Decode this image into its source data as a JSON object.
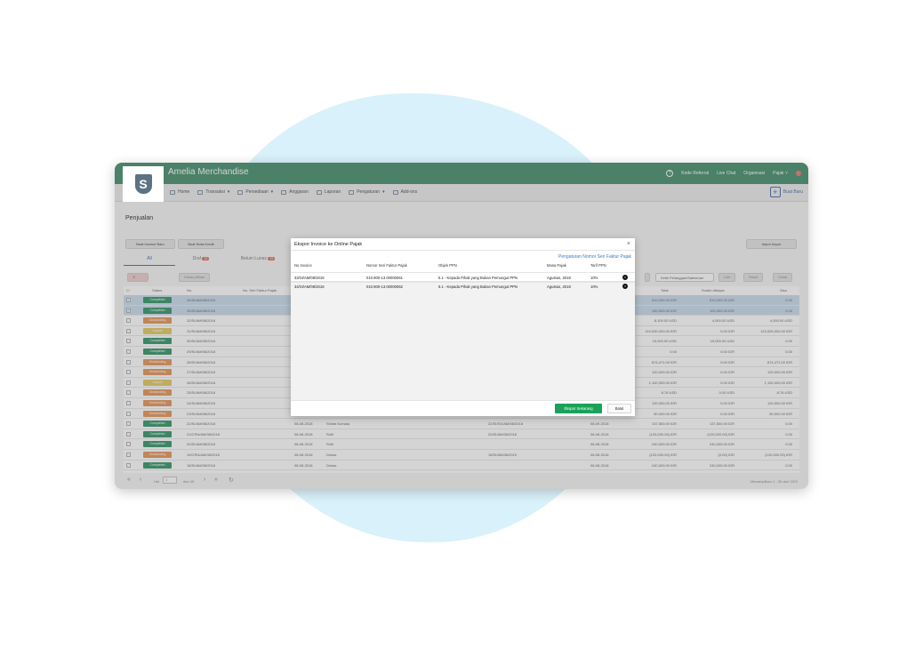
{
  "app": {
    "title": "Amelia Merchandise",
    "logo_letter": "S"
  },
  "topbar": {
    "help": "?",
    "kode_referral": "Kode Referral",
    "live_chat": "Live Chat",
    "organisasi": "Organisasi",
    "user": "Pajak",
    "brand_color": "#5a9c7d"
  },
  "nav": {
    "items": [
      "Home",
      "Transaksi",
      "Persediaan",
      "Anggaran",
      "Laporan",
      "Pengaturan",
      "Add-ons"
    ],
    "create": "Buat Baru"
  },
  "page": {
    "title": "Penjualan",
    "btn_new_invoice": "Buat Invoice Baru",
    "btn_new_credit": "Buat Nota Kredit",
    "btn_import": "Impor Impor",
    "tabs": [
      {
        "label": "All"
      },
      {
        "label": "Draf",
        "count": "10"
      },
      {
        "label": "Belum Lunas",
        "count": "29"
      }
    ],
    "toolbar": {
      "cetak": "Cetak pilihan",
      "search_placeholder": "Ketik Pelanggan/Salesman",
      "cari": "Cari",
      "reset": "Reset",
      "cetak2": "Cetak"
    }
  },
  "table": {
    "headers": {
      "status": "Status",
      "no": "No.",
      "faktur": "No. Seri Faktur Pajak",
      "total": "Total",
      "sudah": "Sudah dibayar",
      "sisa": "Sisa"
    },
    "rows": [
      {
        "selected": true,
        "status": "Completed",
        "color": "#4aa07a",
        "no": "34/SI/AM/08/2018",
        "date": "",
        "cust": "",
        "ref": "",
        "due": "",
        "total": "519,000.00 IDR",
        "paid": "519,000.00 IDR",
        "rest": "0.00"
      },
      {
        "selected": true,
        "status": "Completed",
        "color": "#4aa07a",
        "no": "33/SI/AM/08/2018",
        "date": "",
        "cust": "",
        "ref": "",
        "due": "",
        "total": "100,000.00 IDR",
        "paid": "100,000.00 IDR",
        "rest": "0.00"
      },
      {
        "selected": false,
        "status": "Outstanding",
        "color": "#e7a06a",
        "no": "32/SI/AM/08/2018",
        "date": "",
        "cust": "",
        "ref": "",
        "due": "",
        "total": "8,100.00 USD",
        "paid": "4,000.00 USD",
        "rest": "4,000.00 USD"
      },
      {
        "selected": false,
        "status": "Unpaid",
        "color": "#e6cf72",
        "no": "31/SI/AM/08/2018",
        "date": "",
        "cust": "",
        "ref": "",
        "due": "",
        "total": "110,000,000.00 IDR",
        "paid": "0.00 IDR",
        "rest": "110,000,000.00 IDR"
      },
      {
        "selected": false,
        "status": "Completed",
        "color": "#4aa07a",
        "no": "30/SI/AM/08/2018",
        "date": "",
        "cust": "",
        "ref": "",
        "due": "",
        "total": "15,000.00 USD",
        "paid": "15,000.00 USD",
        "rest": "0.00"
      },
      {
        "selected": false,
        "status": "Completed",
        "color": "#4aa07a",
        "no": "29/SI/AM/08/2018",
        "date": "",
        "cust": "",
        "ref": "",
        "due": "",
        "total": "0.00",
        "paid": "0.00 IDR",
        "rest": "0.00"
      },
      {
        "selected": false,
        "status": "Outstanding",
        "color": "#e7a06a",
        "no": "28/SI/AM/08/2018",
        "date": "",
        "cust": "",
        "ref": "",
        "due": "",
        "total": "874,471.00 IDR",
        "paid": "0.00 IDR",
        "rest": "874,471.00 IDR"
      },
      {
        "selected": false,
        "status": "Outstanding",
        "color": "#e7a06a",
        "no": "27/SI/AM/08/2018",
        "date": "",
        "cust": "",
        "ref": "",
        "due": "",
        "total": "120,000.00 IDR",
        "paid": "0.00 IDR",
        "rest": "120,000.00 IDR"
      },
      {
        "selected": false,
        "status": "Unpaid",
        "color": "#e6cf72",
        "no": "26/SI/AM/08/2018",
        "date": "",
        "cust": "",
        "ref": "",
        "due": "",
        "total": "1,100,000.00 IDR",
        "paid": "0.00 IDR",
        "rest": "1,100,000.00 IDR"
      },
      {
        "selected": false,
        "status": "Outstanding",
        "color": "#e7a06a",
        "no": "25/SI/AM/08/2018",
        "date": "",
        "cust": "",
        "ref": "",
        "due": "",
        "total": "8.76 USD",
        "paid": "0.00 USD",
        "rest": "8.76 USD"
      },
      {
        "selected": false,
        "status": "Outstanding",
        "color": "#e7a06a",
        "no": "24/SI/AM/08/2018",
        "date": "",
        "cust": "",
        "ref": "",
        "due": "",
        "total": "120,000.00 IDR",
        "paid": "0.00 IDR",
        "rest": "120,000.00 IDR"
      },
      {
        "selected": false,
        "status": "Outstanding",
        "color": "#e7a06a",
        "no": "23/SI/AM/08/2018",
        "date": "08-08-2018",
        "cust": "Sulaiha",
        "ref": "10/SI/AM/08/2018",
        "due": "08-08-2018",
        "total": "50,000.00 IDR",
        "paid": "0.00 IDR",
        "rest": "50,000.00 IDR"
      },
      {
        "selected": false,
        "status": "Completed",
        "color": "#4aa07a",
        "no": "22/SI/AM/08/2018",
        "date": "08-08-2018",
        "cust": "Shinta Kumala",
        "ref": "22/SI/SO/AM/08/2018",
        "due": "08-09-2018",
        "total": "137,500.00 IDR",
        "paid": "137,500.00 IDR",
        "rest": "0.00"
      },
      {
        "selected": false,
        "status": "Completed",
        "color": "#4aa07a",
        "no": "21/CRN/AM/08/2018",
        "date": "08-08-2018",
        "cust": "Rofli",
        "ref": "20/SI/AM/08/2018",
        "due": "08-08-2018",
        "total": "(120,000.00) IDR",
        "paid": "(120,000.00) IDR",
        "rest": "0.00"
      },
      {
        "selected": false,
        "status": "Completed",
        "color": "#4aa07a",
        "no": "20/SI/AM/08/2018",
        "date": "08-08-2018",
        "cust": "Rofli",
        "ref": "",
        "due": "08-08-2018",
        "total": "240,000.00 IDR",
        "paid": "240,000.00 IDR",
        "rest": "0.00"
      },
      {
        "selected": false,
        "status": "Outstanding",
        "color": "#e7a06a",
        "no": "19/CRN/AM/08/2018",
        "date": "08-08-2018",
        "cust": "Dimas",
        "ref": "18/SI/AM/08/2019",
        "due": "08-08-2018",
        "total": "(120,000.00) IDR",
        "paid": "(0.00) IDR",
        "rest": "(120,000.00) IDR"
      },
      {
        "selected": false,
        "status": "Completed",
        "color": "#4aa07a",
        "no": "18/SI/AM/08/2018",
        "date": "08-08-2018",
        "cust": "Dimas",
        "ref": "",
        "due": "08-08-2018",
        "total": "240,000.00 IDR",
        "paid": "240,000.00 IDR",
        "rest": "0.00"
      }
    ]
  },
  "footer": {
    "hal": "Hal",
    "page": "1",
    "of": "dari 45",
    "showing": "Menampilkan 1 - 30 dari 1323"
  },
  "modal": {
    "title": "Ekspor Invoice ke Online Pajak",
    "close": "×",
    "settings_link": "Pengaturan Nomor Seri Faktur Pajak",
    "headers": {
      "no_invoice": "No Invoice",
      "nomor_seri": "Nomor Seri Faktur Pajak",
      "objek": "Objek PPN",
      "masa": "Masa Pajak",
      "tarif": "Tarif PPN"
    },
    "rows": [
      {
        "no_invoice": "33/SI/AM/08/2018",
        "nomor_seri": "010.900-13.00000061",
        "objek": "5.1 - Kepada Pihak yang Bukan Pemungut PPN",
        "masa": "Agustus, 2018",
        "tarif": "10%"
      },
      {
        "no_invoice": "34/SI/AM/08/2018",
        "nomor_seri": "010.900-13.00000062",
        "objek": "5.1 - Kepada Pihak yang Bukan Pemungut PPN",
        "masa": "Agustus, 2018",
        "tarif": "10%"
      }
    ],
    "export_btn": "Ekspor Sekarang",
    "cancel_btn": "Batal",
    "export_color": "#1aa25a"
  }
}
